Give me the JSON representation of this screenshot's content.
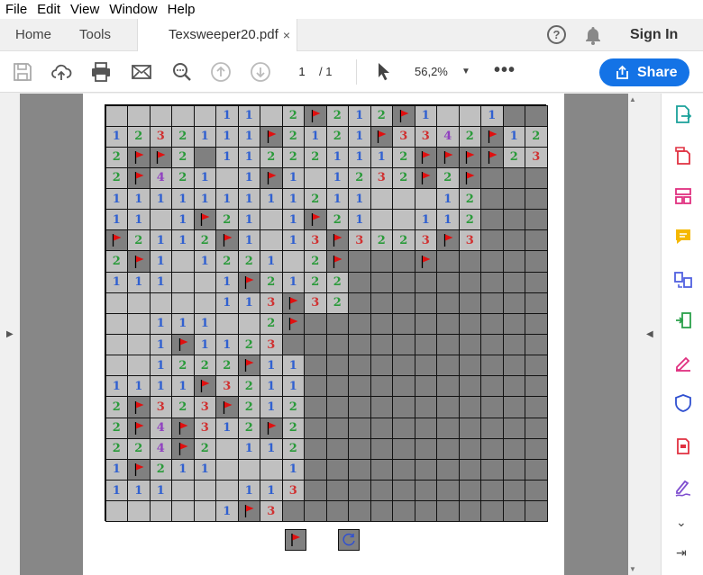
{
  "menu": [
    "File",
    "Edit",
    "View",
    "Window",
    "Help"
  ],
  "tabs": {
    "home": "Home",
    "tools": "Tools",
    "doc": "Texsweeper20.pdf",
    "close": "×"
  },
  "header": {
    "help": "?",
    "signin": "Sign In"
  },
  "toolbar": {
    "page_current": "1",
    "page_total": "/ 1",
    "zoom": "56,2%",
    "more": "•••",
    "share": "Share"
  },
  "colors": {
    "accent": "#1473e6",
    "opened": "#c0c0c0",
    "unopened": "#808080",
    "n1": "#3060d0",
    "n2": "#2a9a3a",
    "n3": "#d03030",
    "n4": "#9040c0"
  },
  "board": {
    "size": [
      20,
      20
    ],
    "legend": "O=opened empty, U=unopened, F=flag on unopened, digit=opened number",
    "rows": [
      "OOOOO11O2F212F1OO1UUU",
      "1232111F2121F3342F12U",
      "2FF2U112221112FFFF23F",
      "2F421O1F1O1232F2FUUUU",
      "111111111211OOO12UUUU",
      "11O1F21O1F21OO112UUUU",
      "F2112F1O13F3223F3UUUU",
      "2F1O1221O2FUUUFUUUUU",
      "111OO1F2122UUUUUUUUU",
      "OOOOO113F32UUUUUUUUU",
      "OO111OO2FUUUUUUUUUUU",
      "OO1F1123UUUUUUUUUUUU",
      "OO1222F11UUUUUUUUUUU",
      "1111F3211UUUUUUUUUUU",
      "2F323F212UUUUUUUUUUU",
      "2F4F312F2UUUUUUUUUUU",
      "224F2O112UUUUUUUUUUU",
      "1F211OOO1UUUUUUUUUUU",
      "111OOO113UUUUUUUUUUU",
      "OOOOO1F3UUUUUUUUUUUU"
    ]
  },
  "controls": {
    "flag": "flag-toggle-icon",
    "reset": "reset-icon"
  }
}
